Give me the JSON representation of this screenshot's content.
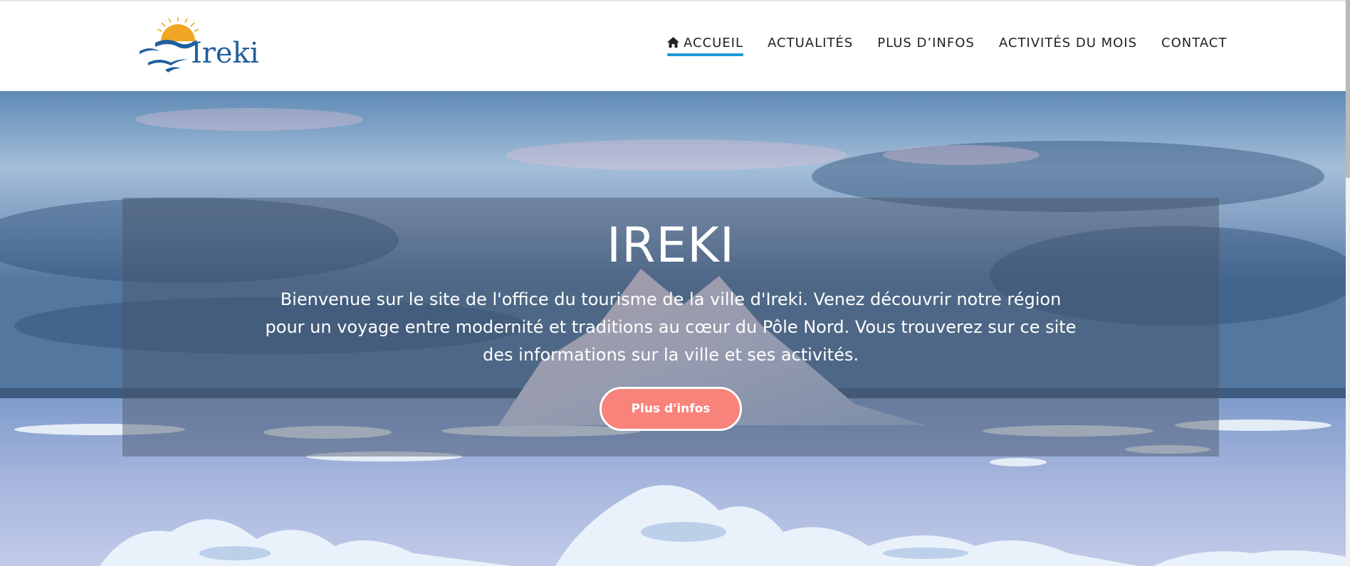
{
  "logo": {
    "text": "Ireki",
    "icon": "sunset-birds-logo-icon"
  },
  "nav": {
    "items": [
      {
        "label": "Accueil",
        "icon": "home-icon",
        "active": true
      },
      {
        "label": "Actualités"
      },
      {
        "label": "Plus d’infos"
      },
      {
        "label": "Activités du mois"
      },
      {
        "label": "Contact"
      }
    ]
  },
  "hero": {
    "title": "IREKI",
    "text": "Bienvenue sur le site de l'office du tourisme de la ville d'Ireki. Venez découvrir notre région pour un voyage entre modernité et traditions au cœur du Pôle Nord. Vous trouverez sur ce site des informations sur la ville et ses activités.",
    "button_label": "Plus d'infos",
    "background": "arctic-iceberg-photo"
  },
  "colors": {
    "accent": "#1e9ad8",
    "brand_blue": "#1f5f9c",
    "logo_sun": "#f0a723",
    "button": "#f8837a"
  }
}
